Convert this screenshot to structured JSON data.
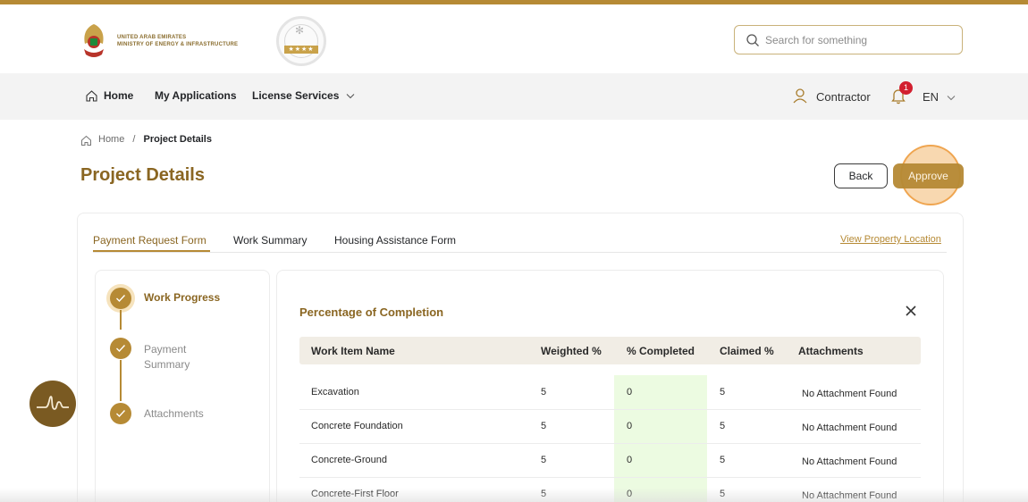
{
  "header": {
    "org_line1": "UNITED ARAB EMIRATES",
    "org_line2": "MINISTRY OF ENERGY & INFRASTRUCTURE",
    "search_placeholder": "Search for something"
  },
  "nav": {
    "home": "Home",
    "my_applications": "My Applications",
    "license_services": "License Services",
    "user": "Contractor",
    "notification_count": "1",
    "language": "EN"
  },
  "breadcrumb": {
    "home": "Home",
    "separator": "/",
    "current": "Project Details"
  },
  "page": {
    "title": "Project Details",
    "back_label": "Back",
    "approve_label": "Approve"
  },
  "tabs": [
    {
      "label": "Payment Request Form",
      "active": true
    },
    {
      "label": "Work Summary",
      "active": false
    },
    {
      "label": "Housing Assistance Form",
      "active": false
    }
  ],
  "view_location": "View Property Location",
  "steps": [
    {
      "label": "Work Progress",
      "active": true
    },
    {
      "label": "Payment Summary",
      "active": false
    },
    {
      "label": "Attachments",
      "active": false
    }
  ],
  "panel": {
    "title": "Percentage of Completion",
    "columns": [
      "Work Item Name",
      "Weighted %",
      "% Completed",
      "Claimed %",
      "Attachments"
    ],
    "rows": [
      [
        "Excavation",
        "5",
        "0",
        "5",
        "No Attachment Found"
      ],
      [
        "Concrete Foundation",
        "5",
        "0",
        "5",
        "No Attachment Found"
      ],
      [
        "Concrete-Ground",
        "5",
        "0",
        "5",
        "No Attachment Found"
      ],
      [
        "Concrete-First Floor",
        "5",
        "0",
        "5",
        "No Attachment Found"
      ]
    ]
  },
  "colors": {
    "brand_gold": "#b68a35",
    "title_gold": "#8a6622",
    "completed_highlight": "#ecfbe1",
    "badge_red": "#d21f2f"
  }
}
